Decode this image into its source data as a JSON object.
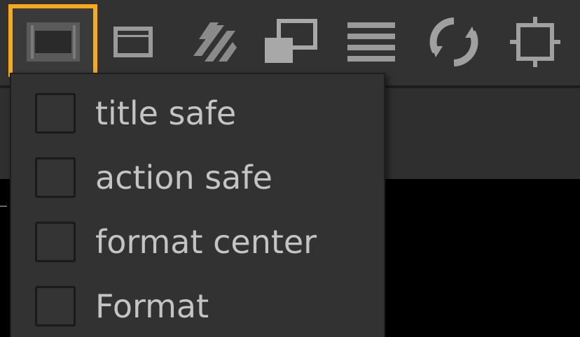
{
  "toolbar": {
    "buttons": [
      {
        "icon": "safe-area-overlay-icon",
        "active": true
      },
      {
        "icon": "frame-icon",
        "active": false
      },
      {
        "icon": "stripes-icon",
        "active": false
      },
      {
        "icon": "overlay-windows-icon",
        "active": false
      },
      {
        "icon": "lines-menu-icon",
        "active": false
      },
      {
        "icon": "refresh-icon",
        "active": false
      },
      {
        "icon": "crosshair-icon",
        "active": false
      }
    ],
    "highlight_color": "#f6aa1c"
  },
  "menu": {
    "items": [
      {
        "label": "title safe",
        "checked": false
      },
      {
        "label": "action safe",
        "checked": false
      },
      {
        "label": "format center",
        "checked": false
      },
      {
        "label": "Format",
        "checked": false
      }
    ]
  }
}
